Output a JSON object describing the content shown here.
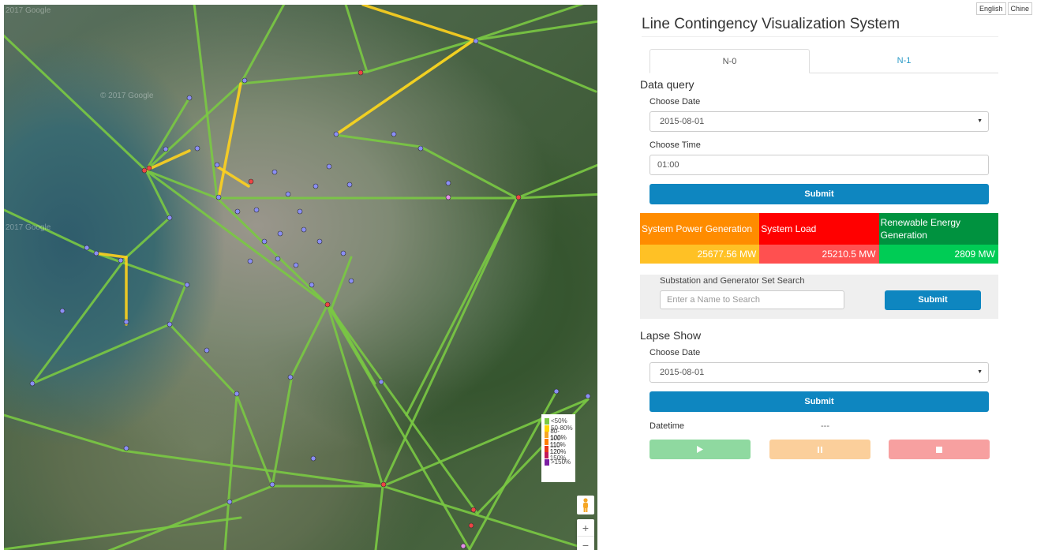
{
  "language": {
    "english": "English",
    "chinese": "Chine"
  },
  "map": {
    "watermark_1": "2017 Google",
    "watermark_2": "© 2017 Google",
    "watermark_3": "2017 Google",
    "legend": [
      {
        "label": "<50%",
        "color": "#7ac943"
      },
      {
        "label": "50-80%",
        "color": "#ffd700"
      },
      {
        "label": "80-100%",
        "color": "#f5a623"
      },
      {
        "label": "100-110%",
        "color": "#ff7f00"
      },
      {
        "label": "110-120%",
        "color": "#e8341c"
      },
      {
        "label": "120-150%",
        "color": "#c2185b"
      },
      {
        "label": ">150%",
        "color": "#7b1fa2"
      }
    ],
    "zoom_in": "+",
    "zoom_out": "−",
    "line_color_normal": "#7ac943",
    "line_color_warn": "#ffd21e",
    "substation_color": "#8a8ef5",
    "generator_color": "#ee4444"
  },
  "panel": {
    "title": "Line Contingency Visualization System",
    "tabs": [
      {
        "label": "N-0"
      },
      {
        "label": "N-1"
      }
    ],
    "data_query": {
      "heading": "Data query",
      "date_label": "Choose Date",
      "date_value": "2015-08-01",
      "time_label": "Choose Time",
      "time_value": "01:00",
      "submit": "Submit"
    },
    "stats": [
      {
        "label": "System Power Generation",
        "value": "25677.56 MW",
        "head_color": "#ff8c00",
        "value_color": "#ffc125"
      },
      {
        "label": "System Load",
        "value": "25210.5 MW",
        "head_color": "#ff0000",
        "value_color": "#ff5050"
      },
      {
        "label": "Renewable Energy Generation",
        "value": "2809 MW",
        "head_color": "#00923f",
        "value_color": "#00cc55"
      }
    ],
    "search": {
      "label": "Substation and Generator Set Search",
      "placeholder": "Enter a Name to Search",
      "submit": "Submit"
    },
    "lapse": {
      "heading": "Lapse Show",
      "date_label": "Choose Date",
      "date_value": "2015-08-01",
      "submit": "Submit",
      "datetime_label": "Datetime",
      "datetime_value": "---",
      "play_color": "#8fd9a0",
      "pause_color": "#fbcf9b",
      "stop_color": "#f7a0a0"
    }
  }
}
